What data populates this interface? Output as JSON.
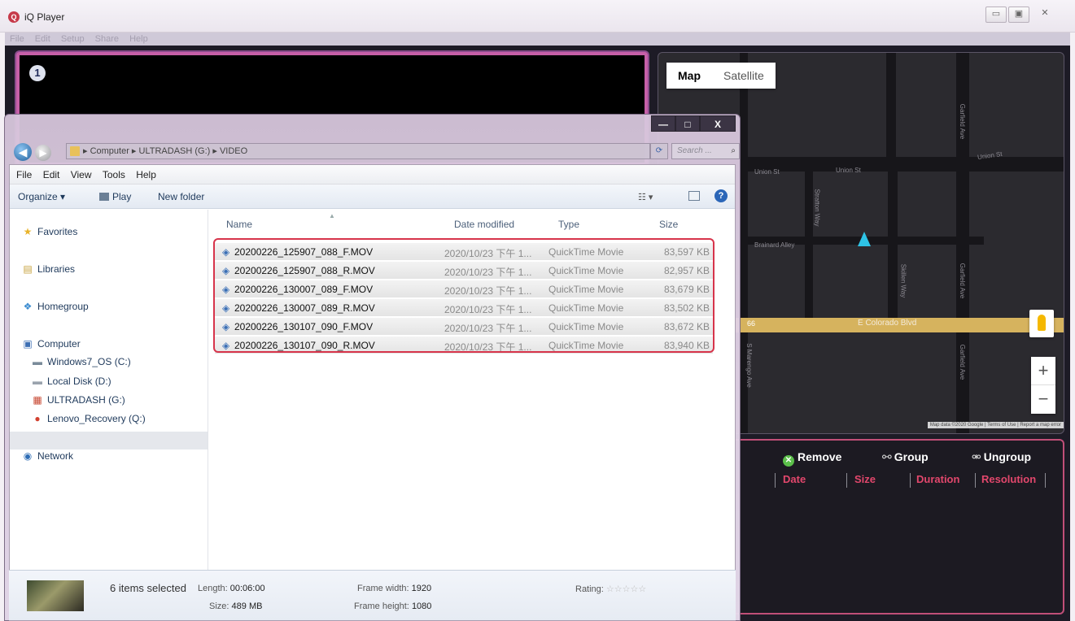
{
  "player": {
    "title": "iQ Player",
    "logo_glyph": "Q",
    "window_controls": [
      "▭",
      "▣",
      "✕"
    ],
    "menu": [
      "File",
      "Edit",
      "Setup",
      "Share",
      "Help"
    ],
    "channel_number": "1"
  },
  "map": {
    "type_buttons": [
      "Map",
      "Satellite"
    ],
    "streets": {
      "union_st_1": "Union St",
      "union_st_2": "Union St",
      "union_st_3": "Union St",
      "stratton_way": "Stratton Way",
      "brainard_alley": "Brainard Alley",
      "skillen_way": "Skillen Way",
      "garfield_ave_1": "Garfield Ave",
      "garfield_ave_2": "Garfield Ave",
      "garfield_ave_3": "Garfield Ave",
      "colorado_blvd": "E Colorado Blvd",
      "route": "66",
      "marengo_ave": "S Marengo Ave"
    },
    "zoom_in": "+",
    "zoom_out": "−",
    "attribution": "Map data ©2020 Google | Terms of Use | Report a map error"
  },
  "file_panel": {
    "remove": "Remove",
    "group": "Group",
    "ungroup": "Ungroup",
    "columns": [
      "Date",
      "Size",
      "Duration",
      "Resolution"
    ]
  },
  "explorer": {
    "window_controls": [
      "—",
      "□",
      "X"
    ],
    "breadcrumb": "▸ Computer ▸ ULTRADASH (G:) ▸ VIDEO",
    "search_placeholder": "Search ...",
    "menu": [
      "File",
      "Edit",
      "View",
      "Tools",
      "Help"
    ],
    "commands": {
      "organize": "Organize ▾",
      "play": "Play",
      "new_folder": "New folder"
    },
    "nav": {
      "favorites": "Favorites",
      "libraries": "Libraries",
      "homegroup": "Homegroup",
      "computer": "Computer",
      "windows_os": "Windows7_OS (C:)",
      "local_disk": "Local Disk (D:)",
      "ultradash": "ULTRADASH (G:)",
      "lenovo": "Lenovo_Recovery (Q:)",
      "network": "Network"
    },
    "columns": {
      "name": "Name",
      "date": "Date modified",
      "type": "Type",
      "size": "Size"
    },
    "files": [
      {
        "name": "20200226_125907_088_F.MOV",
        "date": "2020/10/23 下午 1...",
        "type": "QuickTime Movie",
        "size": "83,597 KB"
      },
      {
        "name": "20200226_125907_088_R.MOV",
        "date": "2020/10/23 下午 1...",
        "type": "QuickTime Movie",
        "size": "82,957 KB"
      },
      {
        "name": "20200226_130007_089_F.MOV",
        "date": "2020/10/23 下午 1...",
        "type": "QuickTime Movie",
        "size": "83,679 KB"
      },
      {
        "name": "20200226_130007_089_R.MOV",
        "date": "2020/10/23 下午 1...",
        "type": "QuickTime Movie",
        "size": "83,502 KB"
      },
      {
        "name": "20200226_130107_090_F.MOV",
        "date": "2020/10/23 下午 1...",
        "type": "QuickTime Movie",
        "size": "83,672 KB"
      },
      {
        "name": "20200226_130107_090_R.MOV",
        "date": "2020/10/23 下午 1...",
        "type": "QuickTime Movie",
        "size": "83,940 KB"
      }
    ],
    "details": {
      "selected": "6 items selected",
      "length_label": "Length:",
      "length": "00:06:00",
      "size_label": "Size:",
      "size": "489 MB",
      "frame_width_label": "Frame width:",
      "frame_width": "1920",
      "frame_height_label": "Frame height:",
      "frame_height": "1080",
      "rating_label": "Rating:",
      "rating_stars": "☆☆☆☆☆"
    }
  },
  "colors": {
    "accent_pink": "#e2476c",
    "video_border": "#c65fa8",
    "selection_red": "#d7344b",
    "nav_arrow": "#2ec3e6",
    "blvd": "#d6b35e"
  }
}
